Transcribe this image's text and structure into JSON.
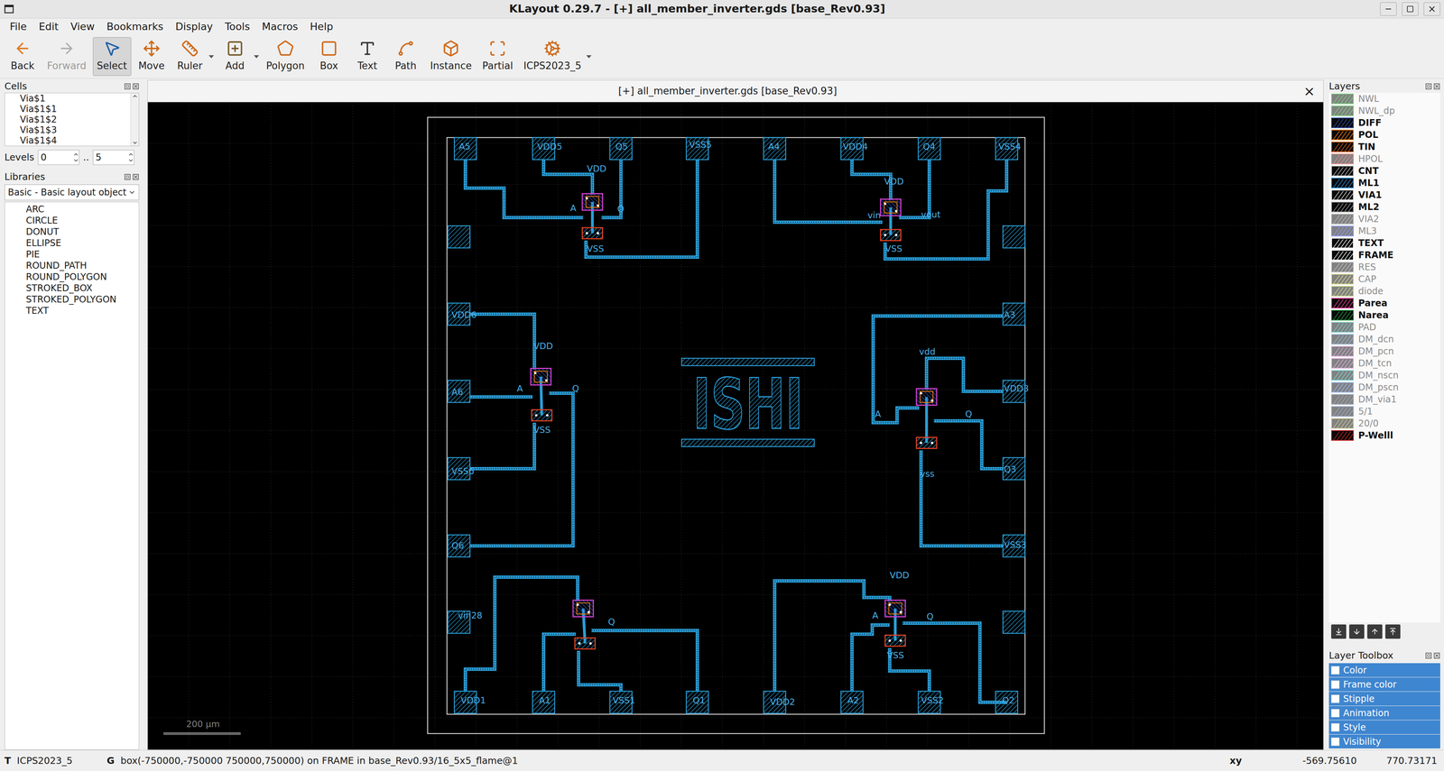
{
  "window": {
    "title": "KLayout 0.29.7 - [+] all_member_inverter.gds [base_Rev0.93]"
  },
  "menu": [
    "File",
    "Edit",
    "View",
    "Bookmarks",
    "Display",
    "Tools",
    "Macros",
    "Help"
  ],
  "toolbar": [
    {
      "label": "Back",
      "selected": false,
      "disabled": false,
      "dropdown": false
    },
    {
      "label": "Forward",
      "selected": false,
      "disabled": true,
      "dropdown": false
    },
    {
      "label": "Select",
      "selected": true,
      "disabled": false,
      "dropdown": false
    },
    {
      "label": "Move",
      "selected": false,
      "disabled": false,
      "dropdown": false
    },
    {
      "label": "Ruler",
      "selected": false,
      "disabled": false,
      "dropdown": true
    },
    {
      "label": "Add",
      "selected": false,
      "disabled": false,
      "dropdown": true
    },
    {
      "label": "Polygon",
      "selected": false,
      "disabled": false,
      "dropdown": false
    },
    {
      "label": "Box",
      "selected": false,
      "disabled": false,
      "dropdown": false
    },
    {
      "label": "Text",
      "selected": false,
      "disabled": false,
      "dropdown": false
    },
    {
      "label": "Path",
      "selected": false,
      "disabled": false,
      "dropdown": false
    },
    {
      "label": "Instance",
      "selected": false,
      "disabled": false,
      "dropdown": false
    },
    {
      "label": "Partial",
      "selected": false,
      "disabled": false,
      "dropdown": false
    },
    {
      "label": "ICPS2023_5",
      "selected": false,
      "disabled": false,
      "dropdown": true
    }
  ],
  "cells": {
    "title": "Cells",
    "items": [
      "Via$1",
      "Via$1$1",
      "Via$1$2",
      "Via$1$3",
      "Via$1$4"
    ]
  },
  "levels": {
    "label": "Levels",
    "from": "0",
    "separator": "..",
    "to": "5"
  },
  "libraries": {
    "title": "Libraries",
    "selected_library": "Basic - Basic layout object",
    "items": [
      "ARC",
      "CIRCLE",
      "DONUT",
      "ELLIPSE",
      "PIE",
      "ROUND_PATH",
      "ROUND_POLYGON",
      "STROKED_BOX",
      "STROKED_POLYGON",
      "TEXT"
    ]
  },
  "view_tab": {
    "title": "[+] all_member_inverter.gds [base_Rev0.93]",
    "close": "×"
  },
  "canvas": {
    "logo": "ISHI",
    "scale_bar": "200 µm",
    "labels": [
      "VDD",
      "A",
      "Q",
      "VSS",
      "VDD",
      "vin",
      "vout",
      "VSS",
      "VDD",
      "A",
      "Q",
      "VSS",
      "vdd",
      "A",
      "Q",
      "vss",
      "Q",
      "VDD",
      "A",
      "Q",
      "VSS",
      "A5",
      "VDD5",
      "Q5",
      "VSS5",
      "A4",
      "VDD4",
      "Q4",
      "VSS4",
      "VDD6",
      "A6",
      "VSS6",
      "Q6",
      "vin28",
      "A3",
      "VDD3",
      "Q3",
      "VSS3",
      "VDD1",
      "A1",
      "VSS1",
      "Q1",
      "VDD2",
      "A2",
      "VSS2",
      "Q2"
    ]
  },
  "layers": {
    "title": "Layers",
    "items": [
      {
        "name": "NWL",
        "visible": false,
        "color": "#00b000"
      },
      {
        "name": "NWL_dp",
        "visible": false,
        "color": "#00b000"
      },
      {
        "name": "DIFF",
        "visible": true,
        "color": "#3050b0"
      },
      {
        "name": "POL",
        "visible": true,
        "color": "#ff8000"
      },
      {
        "name": "TIN",
        "visible": true,
        "color": "#e06010"
      },
      {
        "name": "HPOL",
        "visible": false,
        "color": "#e02020"
      },
      {
        "name": "CNT",
        "visible": true,
        "color": "#c0c0c0"
      },
      {
        "name": "ML1",
        "visible": true,
        "color": "#2090e0"
      },
      {
        "name": "VIA1",
        "visible": true,
        "color": "#e0e0e0"
      },
      {
        "name": "ML2",
        "visible": true,
        "color": "#a0a0a0"
      },
      {
        "name": "VIA2",
        "visible": false,
        "color": "#808080"
      },
      {
        "name": "ML3",
        "visible": false,
        "color": "#2040ff"
      },
      {
        "name": "TEXT",
        "visible": true,
        "color": "#ffffff"
      },
      {
        "name": "FRAME",
        "visible": true,
        "color": "#ffffff"
      },
      {
        "name": "RES",
        "visible": false,
        "color": "#909090"
      },
      {
        "name": "CAP",
        "visible": false,
        "color": "#c0c020"
      },
      {
        "name": "diode",
        "visible": false,
        "color": "#a0c020"
      },
      {
        "name": "Parea",
        "visible": true,
        "color": "#ff40a0"
      },
      {
        "name": "Narea",
        "visible": true,
        "color": "#20a040"
      },
      {
        "name": "PAD",
        "visible": false,
        "color": "#00a0a0"
      },
      {
        "name": "DM_dcn",
        "visible": false,
        "color": "#4080c0"
      },
      {
        "name": "DM_pcn",
        "visible": false,
        "color": "#c060c0"
      },
      {
        "name": "DM_tcn",
        "visible": false,
        "color": "#d070d0"
      },
      {
        "name": "DM_nscn",
        "visible": false,
        "color": "#00c0c0"
      },
      {
        "name": "DM_pscn",
        "visible": false,
        "color": "#4080ff"
      },
      {
        "name": "DM_via1",
        "visible": false,
        "color": "#506080"
      },
      {
        "name": "5/1",
        "visible": false,
        "color": "#4060a0"
      },
      {
        "name": "20/0",
        "visible": false,
        "color": "#a0a030"
      },
      {
        "name": "P-Welll",
        "visible": true,
        "color": "#d02020"
      }
    ]
  },
  "layer_toolbox": {
    "title": "Layer Toolbox",
    "items": [
      {
        "label": "Color",
        "checked": false
      },
      {
        "label": "Frame color",
        "checked": false
      },
      {
        "label": "Stipple",
        "checked": false
      },
      {
        "label": "Animation",
        "checked": false
      },
      {
        "label": "Style",
        "checked": false
      },
      {
        "label": "Visibility",
        "checked": false
      }
    ]
  },
  "status_bar": {
    "tool_key": "T",
    "tool": "ICPS2023_5",
    "info_key": "G",
    "info": "box(-750000,-750000 750000,750000) on FRAME in base_Rev0.93/16_5x5_flame@1",
    "coord_key": "xy",
    "x": "-569.75610",
    "y": "770.73171"
  }
}
